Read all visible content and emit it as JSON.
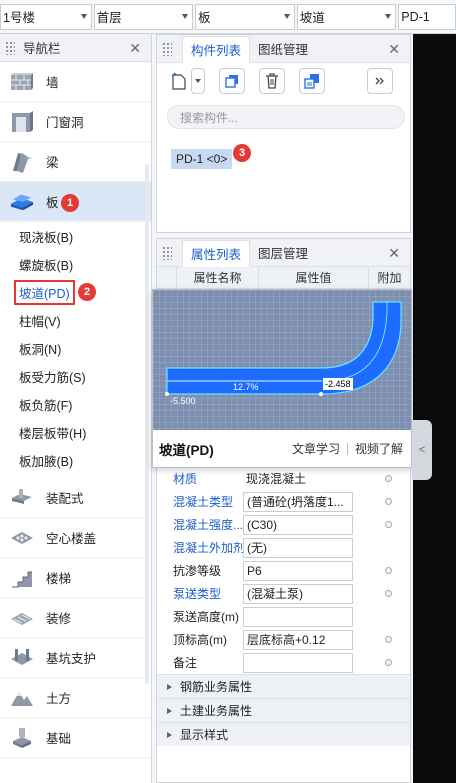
{
  "selectors": [
    {
      "value": "1号楼"
    },
    {
      "value": "首层"
    },
    {
      "value": "板"
    },
    {
      "value": "坡道"
    },
    {
      "value": "PD-1"
    }
  ],
  "nav": {
    "title": "导航栏",
    "items": [
      {
        "label": "墙",
        "icon": "wall-icon"
      },
      {
        "label": "门窗洞",
        "icon": "door-window-icon"
      },
      {
        "label": "梁",
        "icon": "beam-icon"
      },
      {
        "label": "板",
        "icon": "slab-icon"
      },
      {
        "label": "装配式",
        "icon": "prefab-icon"
      },
      {
        "label": "空心楼盖",
        "icon": "hollow-floor-icon"
      },
      {
        "label": "楼梯",
        "icon": "stair-icon"
      },
      {
        "label": "装修",
        "icon": "decoration-icon"
      },
      {
        "label": "基坑支护",
        "icon": "pit-support-icon"
      },
      {
        "label": "土方",
        "icon": "earthwork-icon"
      },
      {
        "label": "基础",
        "icon": "foundation-icon"
      }
    ],
    "sub_items": [
      {
        "label": "现浇板(B)"
      },
      {
        "label": "螺旋板(B)"
      },
      {
        "label": "坡道(PD)"
      },
      {
        "label": "柱帽(V)"
      },
      {
        "label": "板洞(N)"
      },
      {
        "label": "板受力筋(S)"
      },
      {
        "label": "板负筋(F)"
      },
      {
        "label": "楼层板带(H)"
      },
      {
        "label": "板加腋(B)"
      }
    ]
  },
  "badges": {
    "one": "1",
    "two": "2",
    "three": "3"
  },
  "component_panel": {
    "tab_active": "构件列表",
    "tab_other": "图纸管理",
    "search_placeholder": "搜索构件...",
    "component": "PD-1 <0>"
  },
  "property_panel": {
    "tab_active": "属性列表",
    "tab_other": "图层管理",
    "col_name": "属性名称",
    "col_value": "属性值",
    "col_extra": "附加",
    "rows": [
      {
        "name": "材质",
        "value": "现浇混凝土",
        "link": true
      },
      {
        "name": "混凝土类型",
        "value": "(普通砼(坍落度1...",
        "link": true
      },
      {
        "name": "混凝土强度...",
        "value": "(C30)",
        "link": true
      },
      {
        "name": "混凝土外加剂",
        "value": "(无)",
        "link": true
      },
      {
        "name": "抗渗等级",
        "value": "P6",
        "link": false
      },
      {
        "name": "泵送类型",
        "value": "(混凝土泵)",
        "link": true
      },
      {
        "name": "泵送高度(m)",
        "value": "",
        "link": false
      },
      {
        "name": "顶标高(m)",
        "value": "层底标高+0.12",
        "link": false
      },
      {
        "name": "备注",
        "value": "",
        "link": false
      }
    ],
    "groups": [
      "钢筋业务属性",
      "土建业务属性",
      "显示样式"
    ]
  },
  "popup": {
    "title": "坡道(PD)",
    "link_learn": "文章学习",
    "link_video": "视频了解",
    "label_slope": "12.7%",
    "label_low": "-5.500",
    "label_high": "-2.458"
  },
  "colors": {
    "accent": "#1a5fc9",
    "badge": "#e53935",
    "ramp_fill": "#1d6bff",
    "ramp_grid": "#8a9bb8"
  }
}
